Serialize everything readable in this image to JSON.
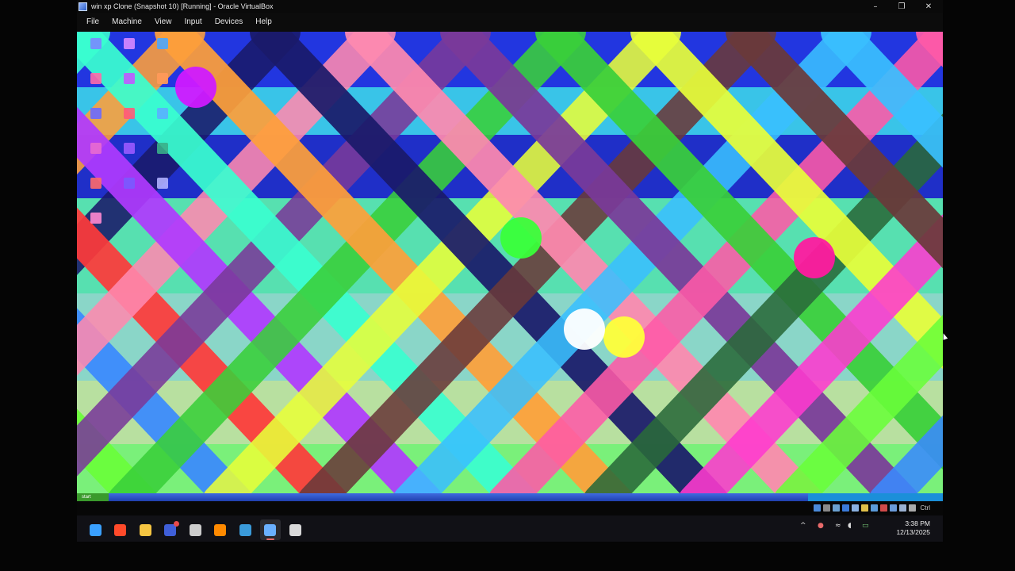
{
  "window": {
    "title": "win xp Clone (Snapshot 10) [Running] - Oracle VirtualBox",
    "controls": {
      "minimize": "–",
      "restore": "❐",
      "close": "✕"
    }
  },
  "menubar": {
    "items": [
      {
        "label": "File"
      },
      {
        "label": "Machine"
      },
      {
        "label": "View"
      },
      {
        "label": "Input"
      },
      {
        "label": "Devices"
      },
      {
        "label": "Help"
      }
    ]
  },
  "guest": {
    "start_label": "start",
    "desktop_icons": [
      {
        "color": "#7a88ff"
      },
      {
        "color": "#d98aff"
      },
      {
        "color": "#4aa6ff"
      },
      {
        "color": "#ff6aa8"
      },
      {
        "color": "#c05aff"
      },
      {
        "color": "#ff9a5a"
      },
      {
        "color": "#6a6aff"
      },
      {
        "color": "#ff5a7a"
      },
      {
        "color": "#5ab0ff"
      },
      {
        "color": "#e86ad0"
      },
      {
        "color": "#9a5aff"
      },
      {
        "color": "#3aaf8a"
      },
      {
        "color": "#ff6a6a"
      },
      {
        "color": "#7a5aff"
      },
      {
        "color": "#b0b0ff"
      },
      {
        "color": "#ff8ad0"
      }
    ]
  },
  "statusbar": {
    "host_key": "Ctrl",
    "icons": [
      "hard-disk-icon",
      "optical-drive-icon",
      "audio-icon",
      "network-icon",
      "usb-icon",
      "shared-folder-icon",
      "display-icon",
      "recording-icon",
      "cpu-icon",
      "mouse-icon",
      "keyboard-icon"
    ]
  },
  "taskbar": {
    "apps": [
      {
        "name": "windows-start-icon",
        "color": "#3aa0ff"
      },
      {
        "name": "brave-browser-icon",
        "color": "#ff4a2a"
      },
      {
        "name": "file-explorer-icon",
        "color": "#f5c542"
      },
      {
        "name": "logseq-icon",
        "color": "#3f5fd9"
      },
      {
        "name": "terminal-icon",
        "color": "#cccccc"
      },
      {
        "name": "vlc-icon",
        "color": "#ff8a00"
      },
      {
        "name": "virtualbox-icon",
        "color": "#3a9ad9"
      },
      {
        "name": "virtualbox-vm-icon",
        "color": "#6ab0ff"
      },
      {
        "name": "chrome-icon",
        "color": "#d9d9d9"
      }
    ],
    "tray": {
      "chevron": "^",
      "mic": "●",
      "wifi": "≈",
      "volume": "◖",
      "battery": "▭"
    },
    "clock": {
      "time": "3:38 PM",
      "date": "12/13/2025"
    }
  }
}
